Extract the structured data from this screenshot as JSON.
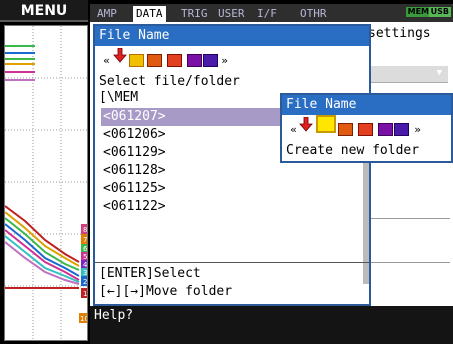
{
  "menu": {
    "title": "MENU"
  },
  "tabs": [
    {
      "label": "AMP",
      "active": false
    },
    {
      "label": "DATA",
      "active": true
    },
    {
      "label": "TRIG",
      "active": false
    },
    {
      "label": "USER",
      "active": false
    },
    {
      "label": "I/F",
      "active": false
    },
    {
      "label": "OTHR",
      "active": false
    }
  ],
  "indicators": {
    "mem": "MEM",
    "usb": "USB"
  },
  "background": {
    "settings_label": "settings",
    "dropdown_arrow": "▼"
  },
  "file_dialog": {
    "title": "File Name",
    "subtitle": "Select file/folder",
    "path": "[\\MEM",
    "items": [
      "<061207>",
      "<061206>",
      "<061129>",
      "<061128>",
      "<061125>",
      "<061122>"
    ],
    "selected_index": 0,
    "hint_enter": "[ENTER]Select",
    "hint_arrows": "[←][→]Move folder"
  },
  "new_folder_dialog": {
    "title": "File Name",
    "label": "Create new folder"
  },
  "icons": {
    "left": "«",
    "right": "»",
    "names": [
      "arrow-down-icon",
      "folder-icon",
      "save-icon",
      "delete-icon",
      "rename-icon",
      "view-icon"
    ]
  },
  "channel_markers": [
    "8",
    "7",
    "6",
    "5",
    "4",
    "3",
    "2",
    "1",
    "10"
  ],
  "help": {
    "text": "Help?"
  }
}
